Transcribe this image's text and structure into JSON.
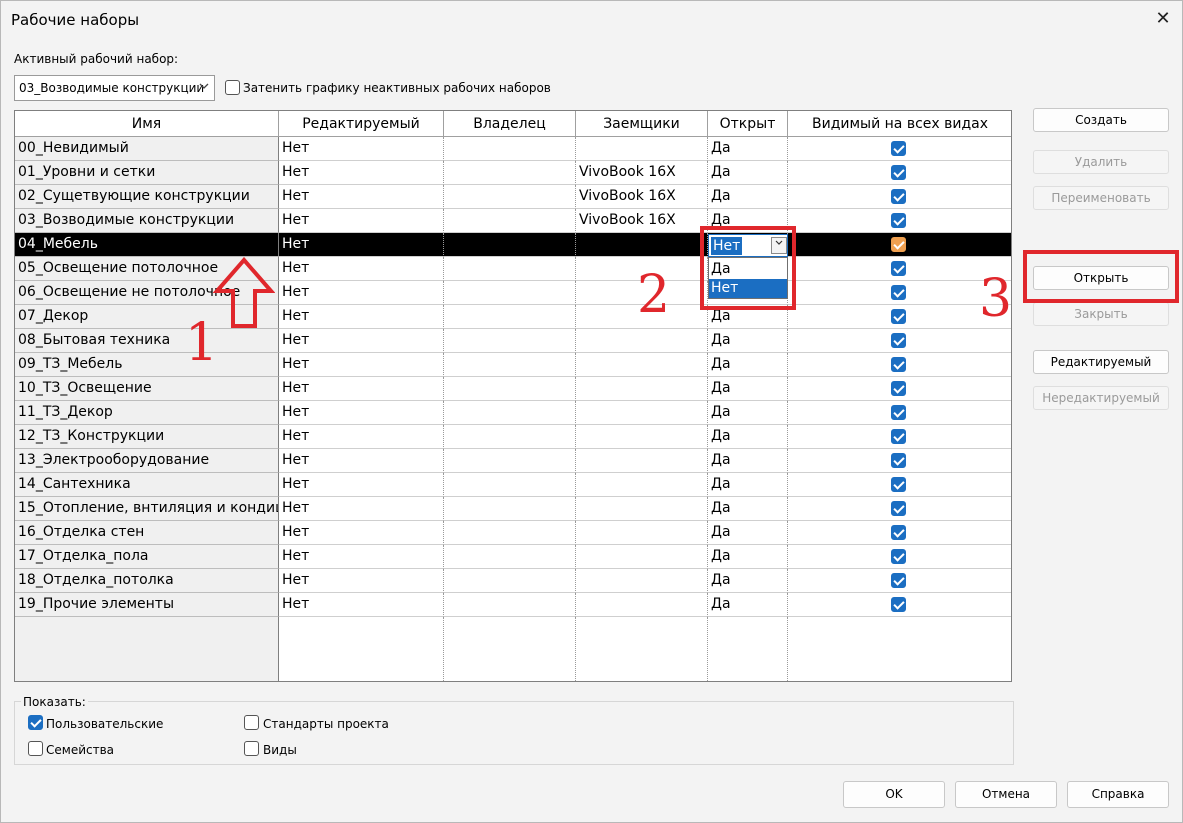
{
  "window": {
    "title": "Рабочие наборы",
    "close_glyph": "✕"
  },
  "active_workset": {
    "label": "Активный рабочий набор:",
    "value": "03_Возводимые конструкции",
    "gray_inactive_label": "Затенить графику неактивных рабочих наборов",
    "gray_inactive_checked": false
  },
  "table": {
    "columns": [
      "Имя",
      "Редактируемый",
      "Владелец",
      "Заемщики",
      "Открыт",
      "Видимый на всех видах"
    ],
    "rows": [
      {
        "name": "00_Невидимый",
        "editable": "Нет",
        "owner": "",
        "borrowers": "",
        "opened": "Да",
        "visible": true
      },
      {
        "name": "01_Уровни и сетки",
        "editable": "Нет",
        "owner": "",
        "borrowers": "VivoBook 16X",
        "opened": "Да",
        "visible": true
      },
      {
        "name": "02_Сущетвующие конструкции",
        "editable": "Нет",
        "owner": "",
        "borrowers": "VivoBook 16X",
        "opened": "Да",
        "visible": true
      },
      {
        "name": "03_Возводимые конструкции",
        "editable": "Нет",
        "owner": "",
        "borrowers": "VivoBook 16X",
        "opened": "Да",
        "visible": true
      },
      {
        "name": "04_Мебель",
        "editable": "Нет",
        "owner": "",
        "borrowers": "",
        "opened": "Нет",
        "visible": true,
        "selected": true
      },
      {
        "name": "05_Освещение потолочное",
        "editable": "Нет",
        "owner": "",
        "borrowers": "",
        "opened": "",
        "visible": true
      },
      {
        "name": "06_Освещение не потолочное",
        "editable": "Нет",
        "owner": "",
        "borrowers": "",
        "opened": "",
        "visible": true
      },
      {
        "name": "07_Декор",
        "editable": "Нет",
        "owner": "",
        "borrowers": "",
        "opened": "Да",
        "visible": true
      },
      {
        "name": "08_Бытовая техника",
        "editable": "Нет",
        "owner": "",
        "borrowers": "",
        "opened": "Да",
        "visible": true
      },
      {
        "name": "09_ТЗ_Мебель",
        "editable": "Нет",
        "owner": "",
        "borrowers": "",
        "opened": "Да",
        "visible": true
      },
      {
        "name": "10_ТЗ_Освещение",
        "editable": "Нет",
        "owner": "",
        "borrowers": "",
        "opened": "Да",
        "visible": true
      },
      {
        "name": "11_ТЗ_Декор",
        "editable": "Нет",
        "owner": "",
        "borrowers": "",
        "opened": "Да",
        "visible": true
      },
      {
        "name": "12_ТЗ_Конструкции",
        "editable": "Нет",
        "owner": "",
        "borrowers": "",
        "opened": "Да",
        "visible": true
      },
      {
        "name": "13_Электрооборудование",
        "editable": "Нет",
        "owner": "",
        "borrowers": "",
        "opened": "Да",
        "visible": true
      },
      {
        "name": "14_Сантехника",
        "editable": "Нет",
        "owner": "",
        "borrowers": "",
        "opened": "Да",
        "visible": true
      },
      {
        "name": "15_Отопление, внтиляция и кондици",
        "editable": "Нет",
        "owner": "",
        "borrowers": "",
        "opened": "Да",
        "visible": true
      },
      {
        "name": "16_Отделка стен",
        "editable": "Нет",
        "owner": "",
        "borrowers": "",
        "opened": "Да",
        "visible": true
      },
      {
        "name": "17_Отделка_пола",
        "editable": "Нет",
        "owner": "",
        "borrowers": "",
        "opened": "Да",
        "visible": true
      },
      {
        "name": "18_Отделка_потолка",
        "editable": "Нет",
        "owner": "",
        "borrowers": "",
        "opened": "Да",
        "visible": true
      },
      {
        "name": "19_Прочие элементы",
        "editable": "Нет",
        "owner": "",
        "borrowers": "",
        "opened": "Да",
        "visible": true
      }
    ]
  },
  "dropdown": {
    "value": "Нет",
    "options": [
      "Да",
      "Нет"
    ],
    "highlighted": "Нет"
  },
  "side_buttons": [
    {
      "id": "create",
      "label": "Создать",
      "enabled": true
    },
    {
      "id": "delete",
      "label": "Удалить",
      "enabled": false
    },
    {
      "id": "rename",
      "label": "Переименовать",
      "enabled": false
    },
    {
      "id": "open",
      "label": "Открыть",
      "enabled": true
    },
    {
      "id": "close",
      "label": "Закрыть",
      "enabled": false
    },
    {
      "id": "editable",
      "label": "Редактируемый",
      "enabled": true
    },
    {
      "id": "noneditable",
      "label": "Нередактируемый",
      "enabled": false
    }
  ],
  "show": {
    "label": "Показать:",
    "options": [
      {
        "label": "Пользовательские",
        "checked": true
      },
      {
        "label": "Стандарты проекта",
        "checked": false
      },
      {
        "label": "Семейства",
        "checked": false
      },
      {
        "label": "Виды",
        "checked": false
      }
    ]
  },
  "bottom_buttons": {
    "ok": "OK",
    "cancel": "Отмена",
    "help": "Справка"
  },
  "annotations": {
    "marker_1": "1",
    "marker_2": "2",
    "marker_3": "3",
    "accent_color": "#e0272c"
  }
}
